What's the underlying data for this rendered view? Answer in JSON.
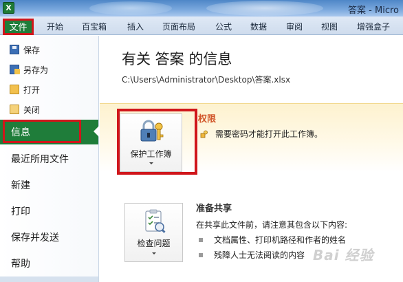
{
  "window": {
    "title": "答案 - Micro"
  },
  "ribbon": {
    "file_tab": "文件",
    "tabs": [
      "开始",
      "百宝箱",
      "插入",
      "页面布局",
      "公式",
      "数据",
      "审阅",
      "视图",
      "增强盒子"
    ]
  },
  "backstage_nav": {
    "commands": [
      {
        "label": "保存",
        "icon": "save-icon"
      },
      {
        "label": "另存为",
        "icon": "save-as-icon"
      },
      {
        "label": "打开",
        "icon": "open-folder-icon"
      },
      {
        "label": "关闭",
        "icon": "close-folder-icon"
      }
    ],
    "items": [
      {
        "label": "信息",
        "active": true
      },
      {
        "label": "最近所用文件"
      },
      {
        "label": "新建"
      },
      {
        "label": "打印"
      },
      {
        "label": "保存并发送"
      },
      {
        "label": "帮助"
      }
    ]
  },
  "info": {
    "heading": "有关 答案 的信息",
    "path": "C:\\Users\\Administrator\\Desktop\\答案.xlsx",
    "permissions": {
      "title": "权限",
      "description": "需要密码才能打开此工作簿。",
      "button_label": "保护工作簿"
    },
    "prepare": {
      "title": "准备共享",
      "description": "在共享此文件前，请注意其包含以下内容:",
      "bullets": [
        "文档属性、打印机路径和作者的姓名",
        "残障人士无法阅读的内容"
      ],
      "button_label": "检查问题"
    }
  },
  "watermark": "Bai 经验",
  "colors": {
    "file_green": "#1f7d3a",
    "highlight_red": "#d0161b",
    "perm_orange": "#d2572b"
  }
}
